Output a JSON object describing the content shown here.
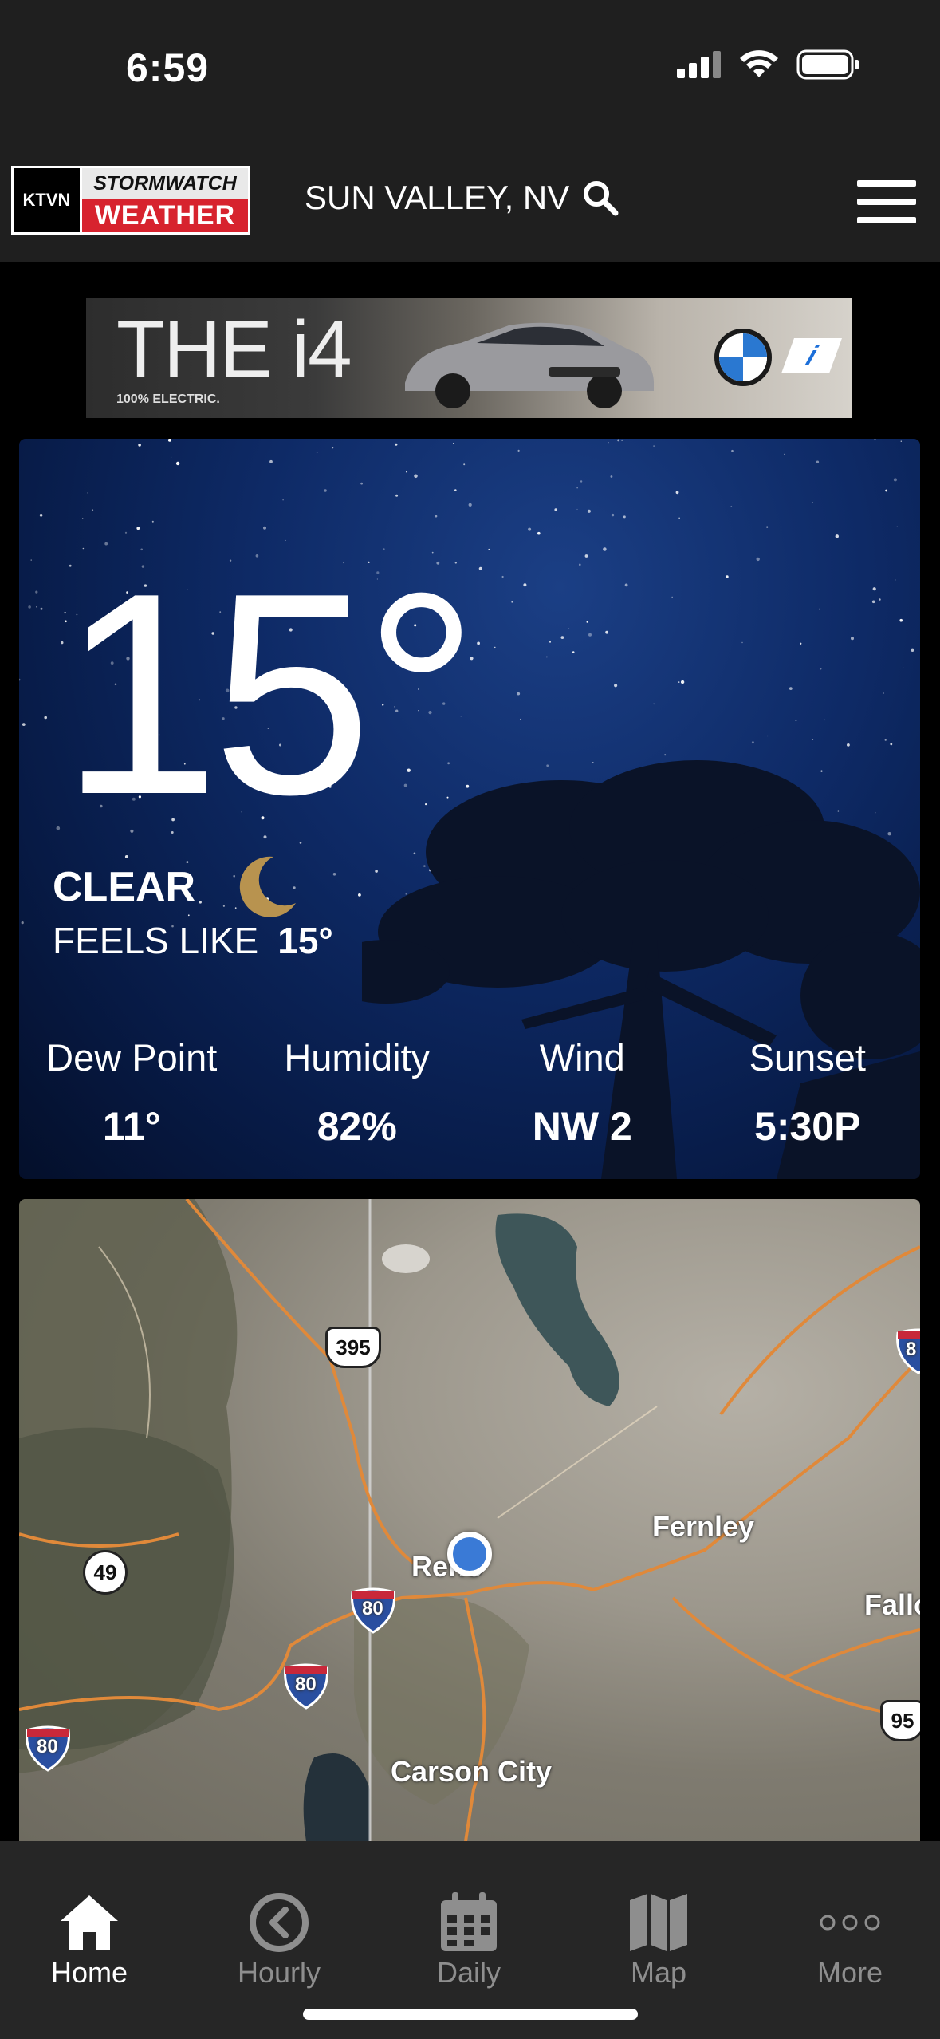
{
  "status_bar": {
    "time": "6:59"
  },
  "header": {
    "logo": {
      "station": "KTVN",
      "brand_top": "STORMWATCH",
      "brand_bottom": "WEATHER"
    },
    "location": "SUN VALLEY, NV"
  },
  "ad": {
    "headline": "THE i4",
    "subline": "100% ELECTRIC."
  },
  "current": {
    "temperature": "15°",
    "condition": "CLEAR",
    "feels_like_label": "FEELS LIKE",
    "feels_like_value": "15°",
    "stats": [
      {
        "label": "Dew Point",
        "value": "11°"
      },
      {
        "label": "Humidity",
        "value": "82%"
      },
      {
        "label": "Wind",
        "value": "NW 2"
      },
      {
        "label": "Sunset",
        "value": "5:30P"
      }
    ]
  },
  "map": {
    "places": [
      "Reno",
      "Fernley",
      "Carson City",
      "Fallo"
    ],
    "shields": [
      "395",
      "49",
      "80",
      "80",
      "80",
      "95",
      "8"
    ]
  },
  "tabs": [
    {
      "label": "Home",
      "icon": "home-icon",
      "active": true
    },
    {
      "label": "Hourly",
      "icon": "clock-icon",
      "active": false
    },
    {
      "label": "Daily",
      "icon": "calendar-icon",
      "active": false
    },
    {
      "label": "Map",
      "icon": "map-icon",
      "active": false
    },
    {
      "label": "More",
      "icon": "more-dots-icon",
      "active": false
    }
  ],
  "colors": {
    "brand_red": "#d7232e",
    "sky_blue": "#0e2a66",
    "tab_bg": "#262626",
    "route_orange": "#e0893a"
  }
}
